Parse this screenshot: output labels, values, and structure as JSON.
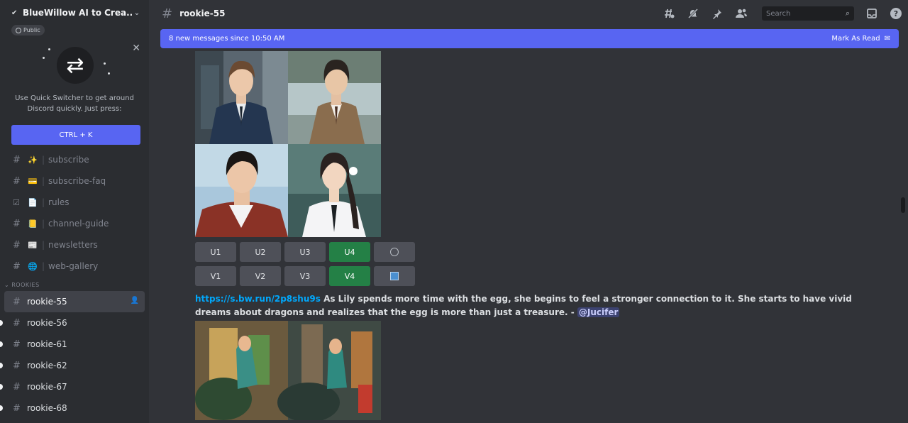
{
  "server": {
    "name": "BlueWillow AI to Crea...",
    "badge": "Public"
  },
  "quick_switcher": {
    "text_line1": "Use Quick Switcher to get around",
    "text_line2": "Discord quickly. Just press:",
    "shortcut": "CTRL + K"
  },
  "channels": [
    {
      "name": "subscribe",
      "emoji": "✨",
      "emoji_icon": "sparkles-icon"
    },
    {
      "name": "subscribe-faq",
      "emoji": "💳",
      "emoji_icon": "credit-card-icon"
    },
    {
      "name": "rules",
      "emoji": "📄",
      "emoji_icon": "page-icon"
    },
    {
      "name": "channel-guide",
      "emoji": "📒",
      "emoji_icon": "ledger-icon"
    },
    {
      "name": "newsletters",
      "emoji": "📰",
      "emoji_icon": "newspaper-icon"
    },
    {
      "name": "web-gallery",
      "emoji": "🌐",
      "emoji_icon": "globe-icon"
    }
  ],
  "category": "ROOKIES",
  "rookie_channels": [
    "rookie-55",
    "rookie-56",
    "rookie-61",
    "rookie-62",
    "rookie-67",
    "rookie-68"
  ],
  "topbar": {
    "channel": "rookie-55",
    "search_placeholder": "Search"
  },
  "banner": {
    "text": "8 new messages since 10:50 AM",
    "mark_read": "Mark As Read"
  },
  "upscale_buttons": [
    "U1",
    "U2",
    "U3",
    "U4"
  ],
  "variation_buttons": [
    "V1",
    "V2",
    "V3",
    "V4"
  ],
  "message": {
    "link": "https://s.bw.run/2p8shu9s",
    "text": "As Lily spends more time with the egg, she begins to feel a stronger connection to it. She starts to have vivid dreams about dragons and realizes that the egg is more than just a treasure. -",
    "mention": "@Jucifer"
  },
  "colors": {
    "accent": "#5865f2",
    "green": "#248046",
    "link": "#00a8fc",
    "bg": "#313338",
    "sidebar": "#2b2d31"
  }
}
